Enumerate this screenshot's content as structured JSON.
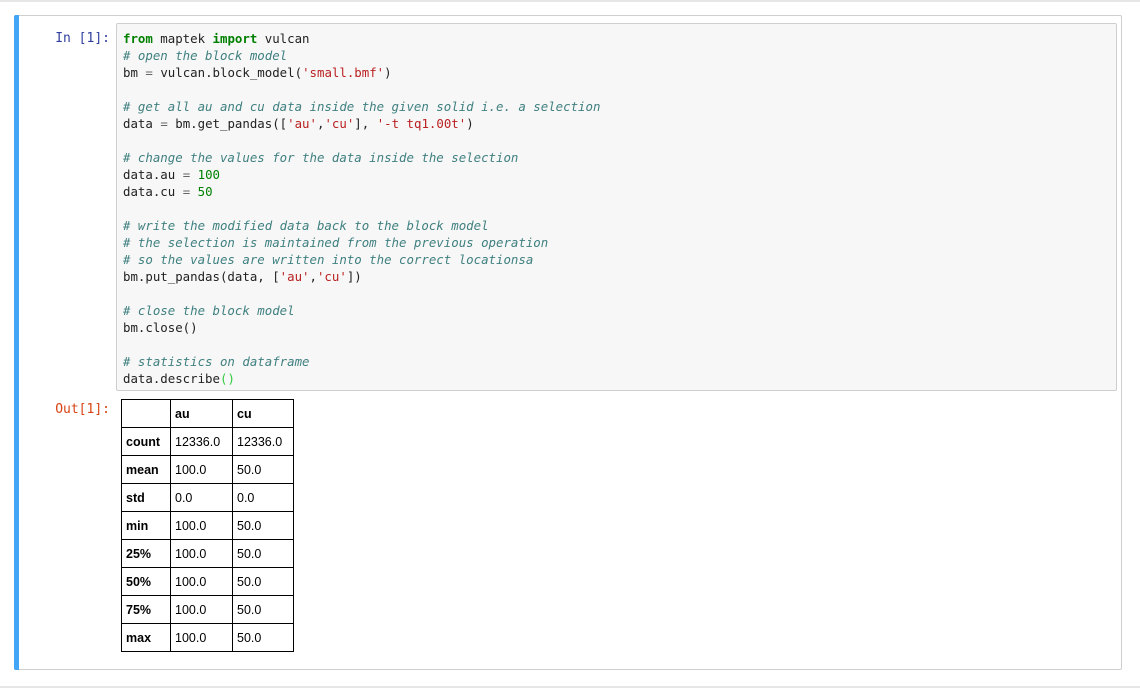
{
  "notebook": {
    "in_prompt": "In [1]:",
    "out_prompt": "Out[1]:",
    "code_lines": [
      [
        {
          "t": "from",
          "c": "kw"
        },
        {
          "t": " maptek ",
          "c": ""
        },
        {
          "t": "import",
          "c": "kw"
        },
        {
          "t": " vulcan",
          "c": ""
        }
      ],
      [
        {
          "t": "# open the block model",
          "c": "cm"
        }
      ],
      [
        {
          "t": "bm ",
          "c": ""
        },
        {
          "t": "=",
          "c": "op"
        },
        {
          "t": " vulcan.block_model(",
          "c": ""
        },
        {
          "t": "'small.bmf'",
          "c": "st"
        },
        {
          "t": ")",
          "c": ""
        }
      ],
      [],
      [
        {
          "t": "# get all au and cu data inside the given solid i.e. a selection",
          "c": "cm"
        }
      ],
      [
        {
          "t": "data ",
          "c": ""
        },
        {
          "t": "=",
          "c": "op"
        },
        {
          "t": " bm.get_pandas([",
          "c": ""
        },
        {
          "t": "'au'",
          "c": "st"
        },
        {
          "t": ",",
          "c": ""
        },
        {
          "t": "'cu'",
          "c": "st"
        },
        {
          "t": "], ",
          "c": ""
        },
        {
          "t": "'-t tq1.00t'",
          "c": "st"
        },
        {
          "t": ")",
          "c": ""
        }
      ],
      [],
      [
        {
          "t": "# change the values for the data inside the selection",
          "c": "cm"
        }
      ],
      [
        {
          "t": "data.au ",
          "c": ""
        },
        {
          "t": "=",
          "c": "op"
        },
        {
          "t": " ",
          "c": ""
        },
        {
          "t": "100",
          "c": "nm"
        }
      ],
      [
        {
          "t": "data.cu ",
          "c": ""
        },
        {
          "t": "=",
          "c": "op"
        },
        {
          "t": " ",
          "c": ""
        },
        {
          "t": "50",
          "c": "nm"
        }
      ],
      [],
      [
        {
          "t": "# write the modified data back to the block model",
          "c": "cm"
        }
      ],
      [
        {
          "t": "# the selection is maintained from the previous operation",
          "c": "cm"
        }
      ],
      [
        {
          "t": "# so the values are written into the correct locationsa",
          "c": "cm"
        }
      ],
      [
        {
          "t": "bm.put_pandas(data, [",
          "c": ""
        },
        {
          "t": "'au'",
          "c": "st"
        },
        {
          "t": ",",
          "c": ""
        },
        {
          "t": "'cu'",
          "c": "st"
        },
        {
          "t": "])",
          "c": ""
        }
      ],
      [],
      [
        {
          "t": "# close the block model",
          "c": "cm"
        }
      ],
      [
        {
          "t": "bm.close()",
          "c": ""
        }
      ],
      [],
      [
        {
          "t": "# statistics on dataframe",
          "c": "cm"
        }
      ],
      [
        {
          "t": "data.describe",
          "c": ""
        },
        {
          "t": "()",
          "c": "br"
        }
      ]
    ],
    "output_table": {
      "columns": [
        "au",
        "cu"
      ],
      "rows": [
        {
          "label": "count",
          "values": [
            "12336.0",
            "12336.0"
          ]
        },
        {
          "label": "mean",
          "values": [
            "100.0",
            "50.0"
          ]
        },
        {
          "label": "std",
          "values": [
            "0.0",
            "0.0"
          ]
        },
        {
          "label": "min",
          "values": [
            "100.0",
            "50.0"
          ]
        },
        {
          "label": "25%",
          "values": [
            "100.0",
            "50.0"
          ]
        },
        {
          "label": "50%",
          "values": [
            "100.0",
            "50.0"
          ]
        },
        {
          "label": "75%",
          "values": [
            "100.0",
            "50.0"
          ]
        },
        {
          "label": "max",
          "values": [
            "100.0",
            "50.0"
          ]
        }
      ]
    }
  },
  "colors": {
    "cell_selected_bar": "#42a5f5",
    "in_prompt": "#303f9f",
    "out_prompt": "#d84315",
    "keyword": "#008000",
    "comment": "#408080",
    "string": "#ba2121"
  }
}
